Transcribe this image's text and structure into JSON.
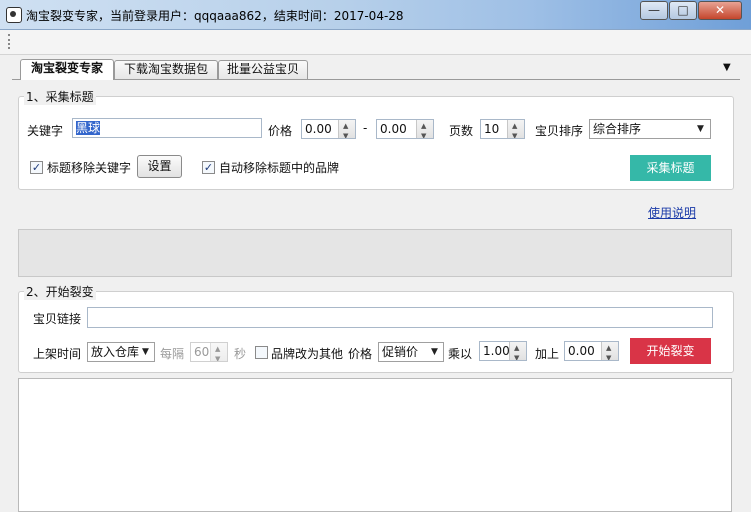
{
  "window": {
    "title": "淘宝裂变专家，当前登录用户：qqqaaa862，结束时间：2017-04-28",
    "min_glyph": "—",
    "max_glyph": "□",
    "close_glyph": "✕"
  },
  "tabs": [
    {
      "label": "淘宝裂变专家",
      "active": true
    },
    {
      "label": "下载淘宝数据包",
      "active": false
    },
    {
      "label": "批量公益宝贝",
      "active": false
    }
  ],
  "collect": {
    "legend": "1、采集标题",
    "keyword_label": "关键字",
    "keyword_value": "黑球",
    "price_label": "价格",
    "price_min": "0.00",
    "price_dash": "-",
    "price_max": "0.00",
    "pages_label": "页数",
    "pages_value": "10",
    "sort_label": "宝贝排序",
    "sort_value": "综合排序",
    "remove_keyword_label": "标题移除关键字",
    "remove_keyword_checked": true,
    "settings_button": "设置",
    "remove_brand_label": "自动移除标题中的品牌",
    "remove_brand_checked": true,
    "collect_button": "采集标题",
    "collect_button_color": "#35b8a8"
  },
  "help_link": "使用说明",
  "fission": {
    "legend": "2、开始裂变",
    "item_link_label": "宝贝链接",
    "item_link_value": "",
    "listing_time_label": "上架时间",
    "listing_time_value": "放入仓库",
    "interval_label": "每隔",
    "interval_value": "60",
    "seconds_label": "秒",
    "brand_other_label": "品牌改为其他",
    "brand_other_checked": false,
    "price_label": "价格",
    "price_mode_value": "促销价",
    "multiply_label": "乘以",
    "multiply_value": "1.00",
    "add_label": "加上",
    "add_value": "0.00",
    "start_button": "开始裂变",
    "start_button_color": "#d93447"
  },
  "check_glyph": "✓",
  "dropdown_glyph": "▼"
}
